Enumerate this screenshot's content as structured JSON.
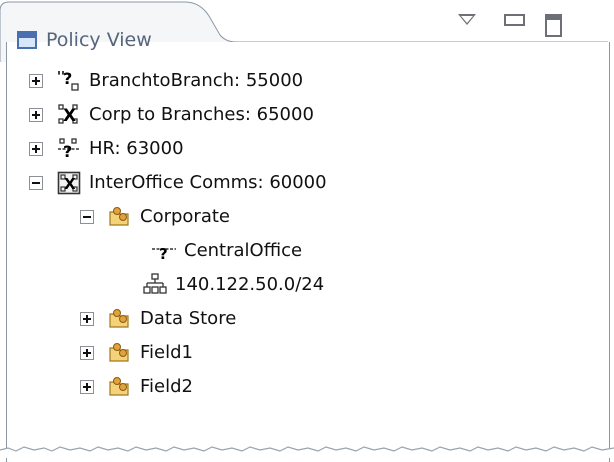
{
  "view": {
    "title": "Policy View",
    "menu_icon": "view-menu-triangle",
    "minimize_icon": "minimize",
    "maximize_icon": "maximize"
  },
  "tree": {
    "policies": [
      {
        "label": "BranchtoBranch: 55000",
        "icon": "policy-partial-icon",
        "expanded": false
      },
      {
        "label": "Corp to Branches: 65000",
        "icon": "policy-mesh-icon",
        "expanded": false
      },
      {
        "label": "HR: 63000",
        "icon": "policy-hubspoke-icon",
        "expanded": false
      },
      {
        "label": "InterOffice Comms: 60000",
        "icon": "policy-meshbox-icon",
        "expanded": true
      }
    ],
    "groups": [
      {
        "label": "Corporate",
        "icon": "group-icon",
        "expanded": true
      },
      {
        "label": "Data Store",
        "icon": "group-icon",
        "expanded": false
      },
      {
        "label": "Field1",
        "icon": "group-icon",
        "expanded": false
      },
      {
        "label": "Field2",
        "icon": "group-icon",
        "expanded": false
      }
    ],
    "corporate_children": [
      {
        "label": "CentralOffice",
        "icon": "gateway-icon"
      },
      {
        "label": "140.122.50.0/24",
        "icon": "network-icon"
      }
    ]
  }
}
